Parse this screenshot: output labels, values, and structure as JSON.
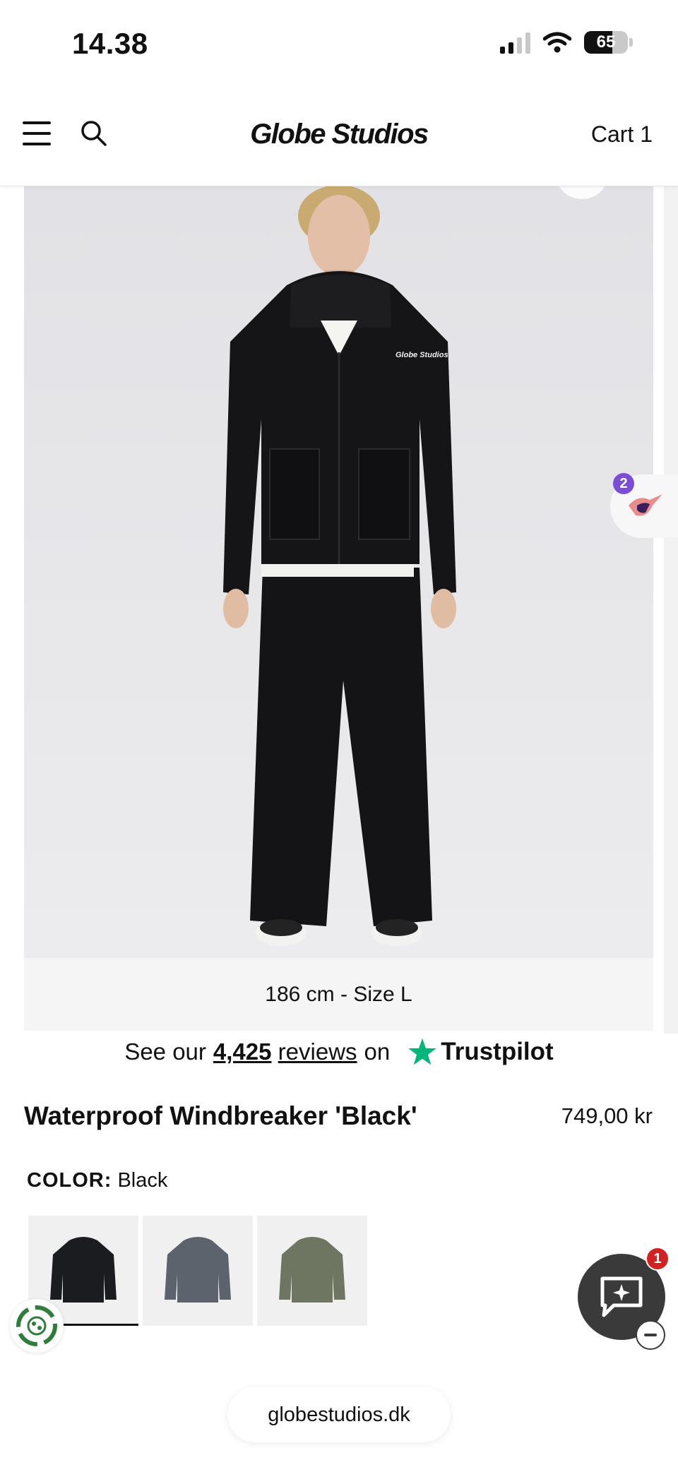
{
  "status_bar": {
    "time": "14.38",
    "battery": "65",
    "battery_level": 0.65,
    "signal_bars_active": 2,
    "signal_bars_total": 4
  },
  "header": {
    "logo": "Globe Studios",
    "cart_label": "Cart 1"
  },
  "gallery": {
    "caption": "186 cm - Size L",
    "print_on_jacket": "Globe Studios",
    "side_widget_badge": "2"
  },
  "trustpilot": {
    "prefix": "See our",
    "count": "4,425",
    "reviews_word": "reviews",
    "on_word": "on",
    "brand": "Trustpilot",
    "star_color": "#00b67a"
  },
  "product": {
    "title": "Waterproof Windbreaker 'Black'",
    "price": "749,00 kr",
    "color_label": "COLOR:",
    "color_value": "Black",
    "swatches": [
      {
        "color": "#1b1c20",
        "selected": true
      },
      {
        "color": "#5c636d",
        "selected": false
      },
      {
        "color": "#6e7561",
        "selected": false
      }
    ]
  },
  "chat": {
    "badge": "1"
  },
  "browser": {
    "url": "globestudios.dk"
  }
}
